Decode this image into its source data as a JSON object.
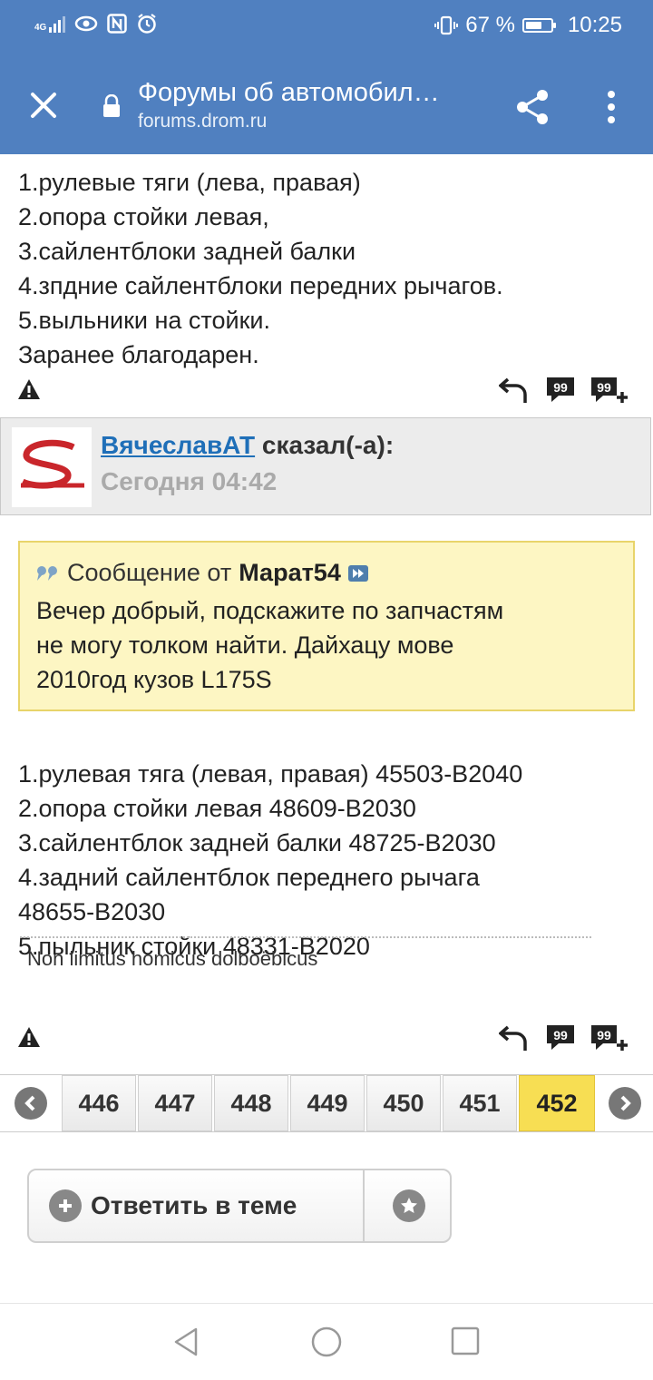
{
  "status_bar": {
    "network": "4G",
    "battery_percent": "67 %",
    "battery_level": 0.67,
    "time": "10:25",
    "icons": [
      "signal-icon",
      "eye-icon",
      "nfc-icon",
      "alarm-icon",
      "vibrate-icon",
      "battery-icon"
    ]
  },
  "browser": {
    "title": "Форумы об автомобил…",
    "url": "forums.drom.ru",
    "icons": [
      "close-icon",
      "lock-icon",
      "share-icon",
      "more-vert-icon"
    ]
  },
  "first_post": {
    "lines": [
      "1.рулевые тяги (лева, правая)",
      "2.опора стойки левая,",
      "3.сайлентблоки задней балки",
      "4.зпдние сайлентблоки передних рычагов.",
      "5.выльники на стойки.",
      "Заранее благодарен."
    ]
  },
  "post_actions": {
    "icons": [
      "report-icon",
      "reply-arrow-icon",
      "quote-icon",
      "multi-quote-icon"
    ]
  },
  "quote_header": {
    "author": "ВячеславАТ",
    "said": "сказал(-а):",
    "date": "Сегодня 04:42"
  },
  "quote": {
    "prefix": "Сообщение от",
    "author": "Марат54",
    "body": "Вечер добрый, подскажите по запчастям\nне могу толком найти. Дайхацу мове\n2010год кузов L175S"
  },
  "answer": {
    "lines": [
      "1.рулевая тяга (левая, правая) 45503-B2040",
      "2.опора стойки левая 48609-B2030",
      "3.сайлентблок задней балки 48725-B2030",
      "4.задний сайлентблок переднего рычага",
      "48655-B2030",
      "5.пыльник стойки 48331-B2020"
    ],
    "signature": "Non limitus homicus dolboëbicus"
  },
  "pagination": {
    "pages": [
      "446",
      "447",
      "448",
      "449",
      "450",
      "451",
      "452"
    ],
    "active": "452"
  },
  "reply": {
    "label": "Ответить в теме",
    "icons": [
      "plus-icon",
      "star-icon"
    ]
  },
  "system_nav": {
    "icons": [
      "back-icon",
      "home-icon",
      "recents-icon"
    ]
  },
  "colors": {
    "header": "#5080c0",
    "link": "#1f6fb8",
    "quote_bg": "#fdf6c3",
    "quote_border": "#e8d46a",
    "active_page": "#f7de53"
  }
}
